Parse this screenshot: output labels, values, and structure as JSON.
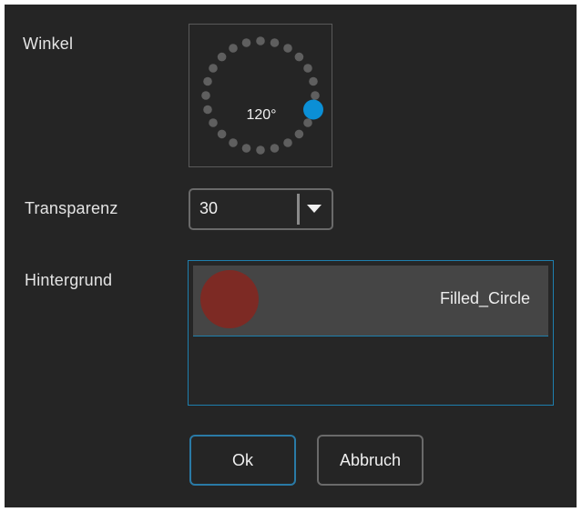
{
  "labels": {
    "angle": "Winkel",
    "transparency": "Transparenz",
    "background": "Hintergrund"
  },
  "angle_dial": {
    "value_text": "120°",
    "angle_degrees": 120,
    "handle_color": "#0b8fd6",
    "dot_color": "#5f5f5f"
  },
  "transparency": {
    "selected_value": "30"
  },
  "background_list": {
    "items": [
      {
        "label": "Filled_Circle",
        "swatch_color": "#7d2a24"
      }
    ]
  },
  "buttons": {
    "ok_label": "Ok",
    "cancel_label": "Abbruch"
  },
  "colors": {
    "dialog_bg": "#252525",
    "accent": "#1e7fae"
  }
}
